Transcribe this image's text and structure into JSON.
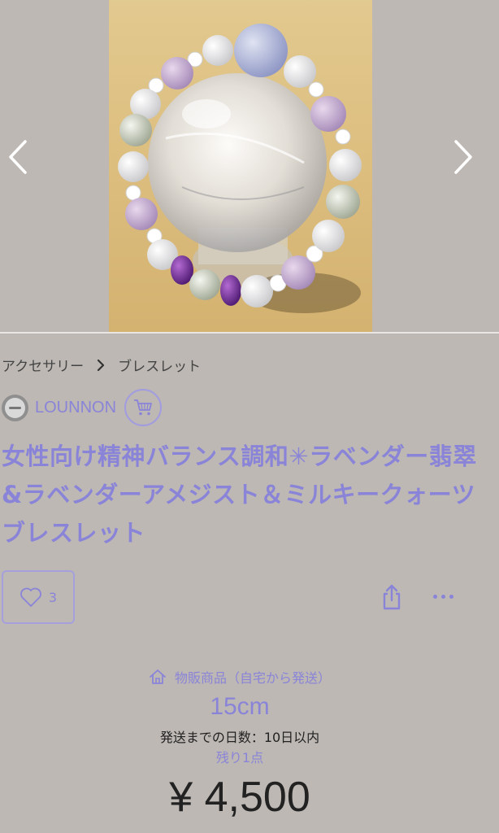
{
  "gallery": {
    "prev_icon": "chevron-left-icon",
    "next_icon": "chevron-right-icon",
    "image_subject": "bracelet"
  },
  "breadcrumb": {
    "category": "アクセサリー",
    "subcategory": "ブレスレット",
    "separator_icon": "chevron-right-icon"
  },
  "shop": {
    "name": "LOUNNON",
    "cart_icon": "cart-icon"
  },
  "product": {
    "title": "女性向け精神バランス調和✳︎ラベンダー翡翠&ラベンダーアメジスト＆ミルキークォーツ　ブレスレット",
    "like_count": "3",
    "sale_type": "物販商品（自宅から発送）",
    "variant": "15cm",
    "shipping_days": "発送までの日数：10日以内",
    "stock": "残り1点",
    "price": "¥ 4,500"
  },
  "colors": {
    "accent": "#8a84d8",
    "background": "#bdb8b4",
    "text": "#222222"
  },
  "icons": [
    "chevron-left-icon",
    "chevron-right-icon",
    "cart-icon",
    "heart-icon",
    "share-icon",
    "more-icon",
    "house-icon"
  ]
}
